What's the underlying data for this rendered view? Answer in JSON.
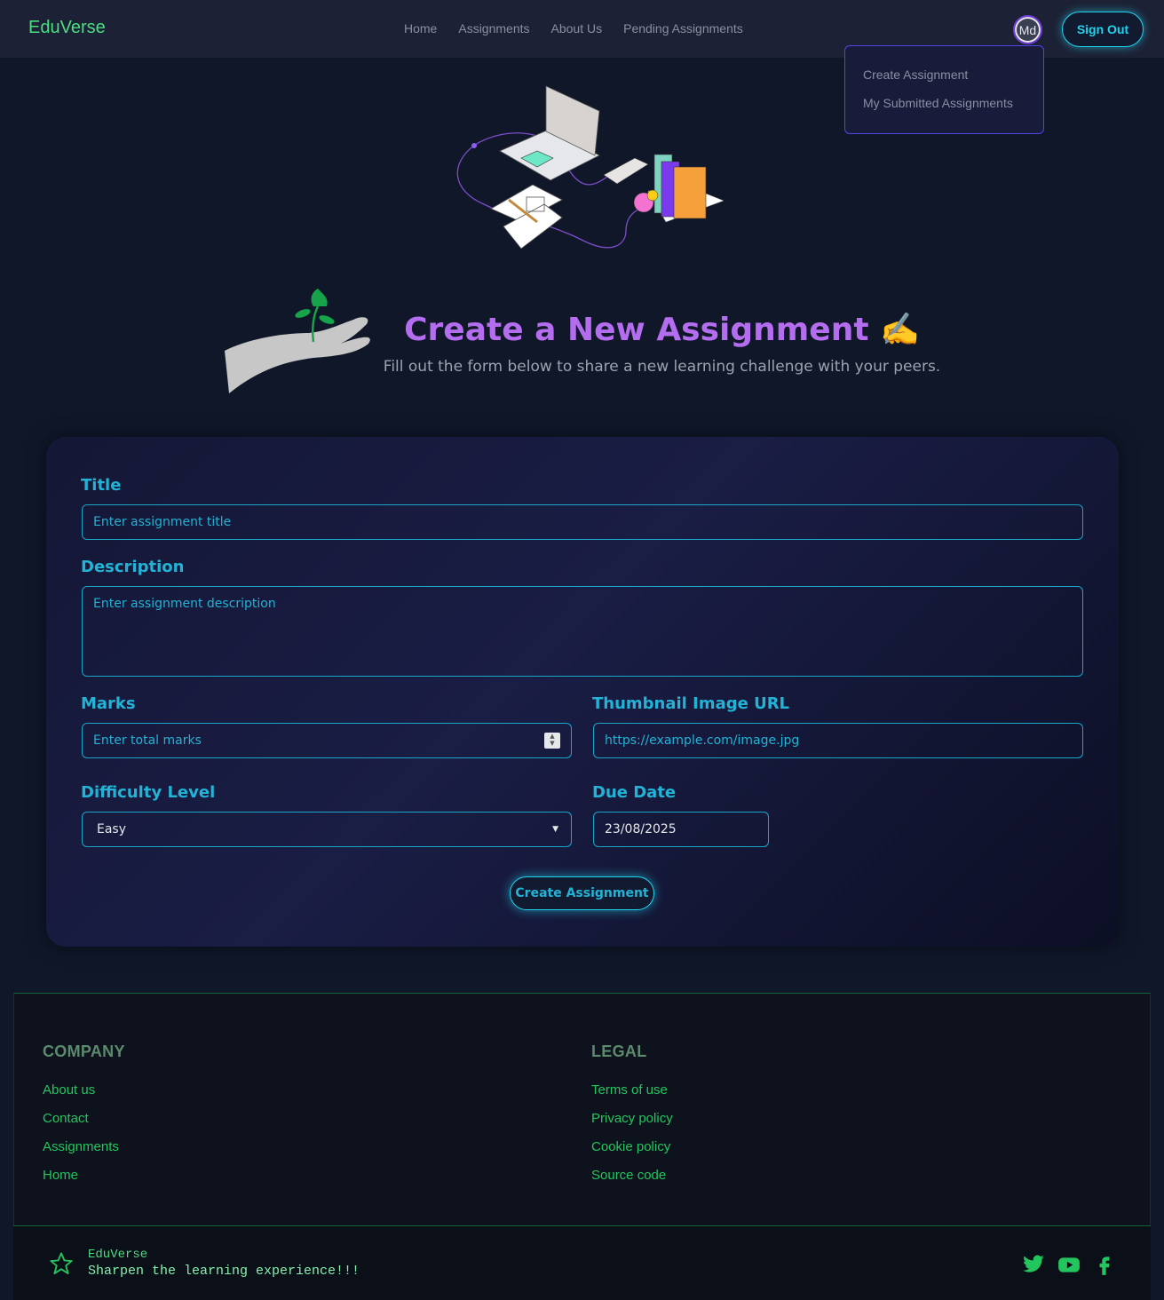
{
  "navbar": {
    "brand": "EduVerse",
    "links": [
      "Home",
      "Assignments",
      "About Us",
      "Pending Assignments"
    ],
    "avatar_initials": "Md",
    "signout_label": "Sign Out",
    "dropdown": [
      "Create Assignment",
      "My Submitted Assignments"
    ]
  },
  "hero": {
    "heading": "Create a New Assignment ✍️",
    "subheading": "Fill out the form below to share a new learning challenge with your peers."
  },
  "form": {
    "title_label": "Title",
    "title_placeholder": "Enter assignment title",
    "description_label": "Description",
    "description_placeholder": "Enter assignment description",
    "marks_label": "Marks",
    "marks_placeholder": "Enter total marks",
    "thumbnail_label": "Thumbnail Image URL",
    "thumbnail_placeholder": "https://example.com/image.jpg",
    "difficulty_label": "Difficulty Level",
    "difficulty_value": "Easy",
    "due_date_label": "Due Date",
    "due_date_value": "23/08/2025",
    "submit_label": "Create Assignment"
  },
  "footer": {
    "company_title": "COMPANY",
    "company_links": [
      "About us",
      "Contact",
      "Assignments",
      "Home"
    ],
    "legal_title": "LEGAL",
    "legal_links": [
      "Terms of use",
      "Privacy policy",
      "Cookie policy",
      "Source code"
    ],
    "brand": "EduVerse",
    "tagline": "Sharpen the learning experience!!!",
    "social_icons": [
      "twitter-icon",
      "youtube-icon",
      "facebook-icon"
    ]
  },
  "colors": {
    "accent_cyan": "#22d3ee",
    "heading_purple": "#b56df0",
    "brand_green": "#4ade80"
  }
}
